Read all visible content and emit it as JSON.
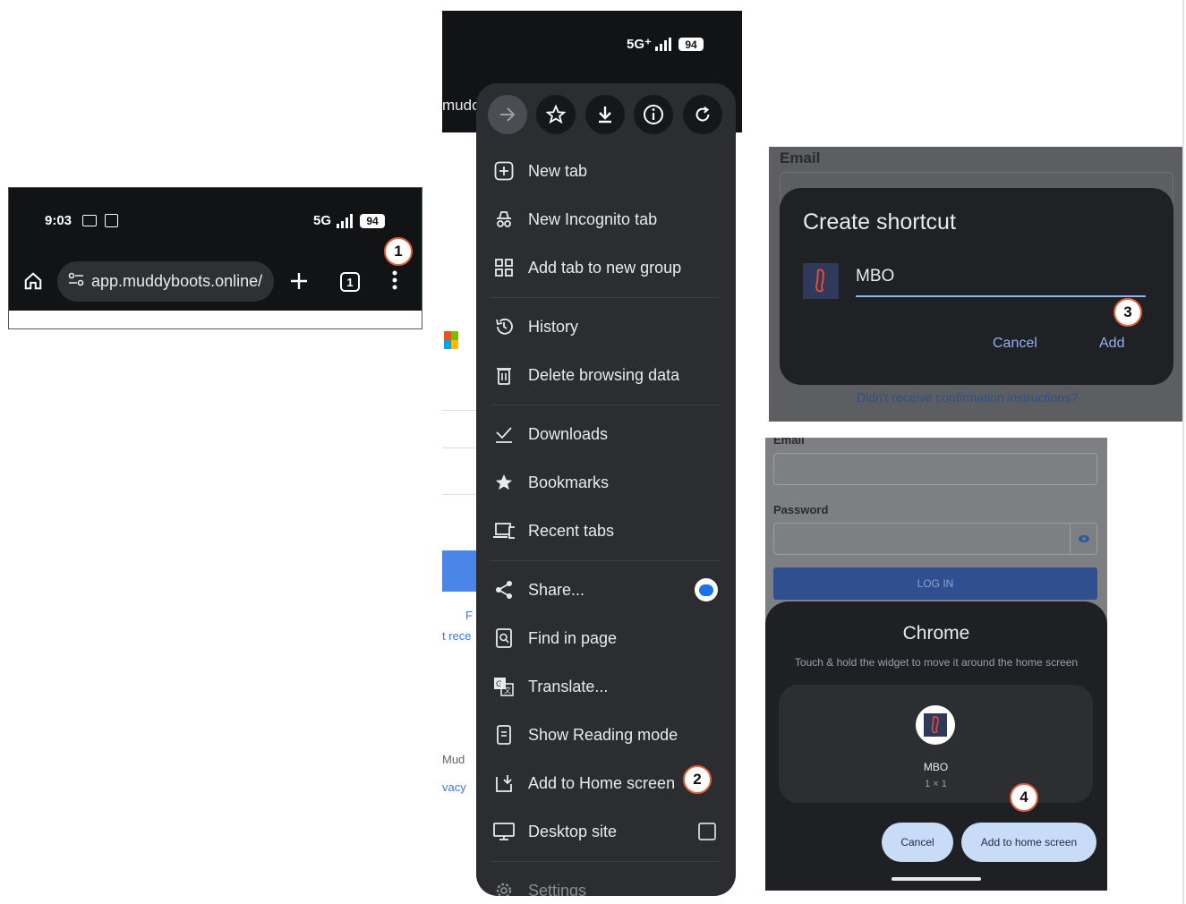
{
  "panel1": {
    "time": "9:03",
    "network": "5G",
    "battery": "94",
    "url": "app.muddyboots.online/",
    "step": "1"
  },
  "panel2": {
    "network": "5G⁺",
    "battery": "94",
    "partial_url": "mudc",
    "partial_text": [
      "F",
      "t rece",
      "Mud",
      "vacy"
    ],
    "menu_items": [
      {
        "label": "New tab",
        "icon": "plus-square-icon"
      },
      {
        "label": "New Incognito tab",
        "icon": "incognito-icon"
      },
      {
        "label": "Add tab to new group",
        "icon": "tab-group-icon"
      },
      {
        "label": "History",
        "icon": "history-icon"
      },
      {
        "label": "Delete browsing data",
        "icon": "trash-icon"
      },
      {
        "label": "Downloads",
        "icon": "download-check-icon"
      },
      {
        "label": "Bookmarks",
        "icon": "star-icon"
      },
      {
        "label": "Recent tabs",
        "icon": "devices-icon"
      },
      {
        "label": "Share...",
        "icon": "share-icon"
      },
      {
        "label": "Find in page",
        "icon": "find-icon"
      },
      {
        "label": "Translate...",
        "icon": "translate-icon"
      },
      {
        "label": "Show Reading mode",
        "icon": "reading-mode-icon"
      },
      {
        "label": "Add to Home screen",
        "icon": "add-home-icon"
      },
      {
        "label": "Desktop site",
        "icon": "desktop-icon"
      },
      {
        "label": "Settings",
        "icon": "gear-icon"
      }
    ],
    "step": "2"
  },
  "panel3": {
    "email_label": "Email",
    "title": "Create shortcut",
    "shortcut_name": "MBO",
    "cancel": "Cancel",
    "add": "Add",
    "link": "Didn't receive confirmation instructions?",
    "step": "3"
  },
  "panel4": {
    "email_label": "Email",
    "password_label": "Password",
    "login": "LOG IN",
    "sheet_title": "Chrome",
    "hint": "Touch & hold the widget to move it around the home screen",
    "widget_name": "MBO",
    "widget_size": "1 × 1",
    "cancel": "Cancel",
    "add_home": "Add to home screen",
    "step": "4"
  },
  "colors": {
    "dark_bg": "#121315",
    "menu_bg": "#2b2d31",
    "accent_blue": "#8ab4f8",
    "step_ring": "#e0603a"
  }
}
